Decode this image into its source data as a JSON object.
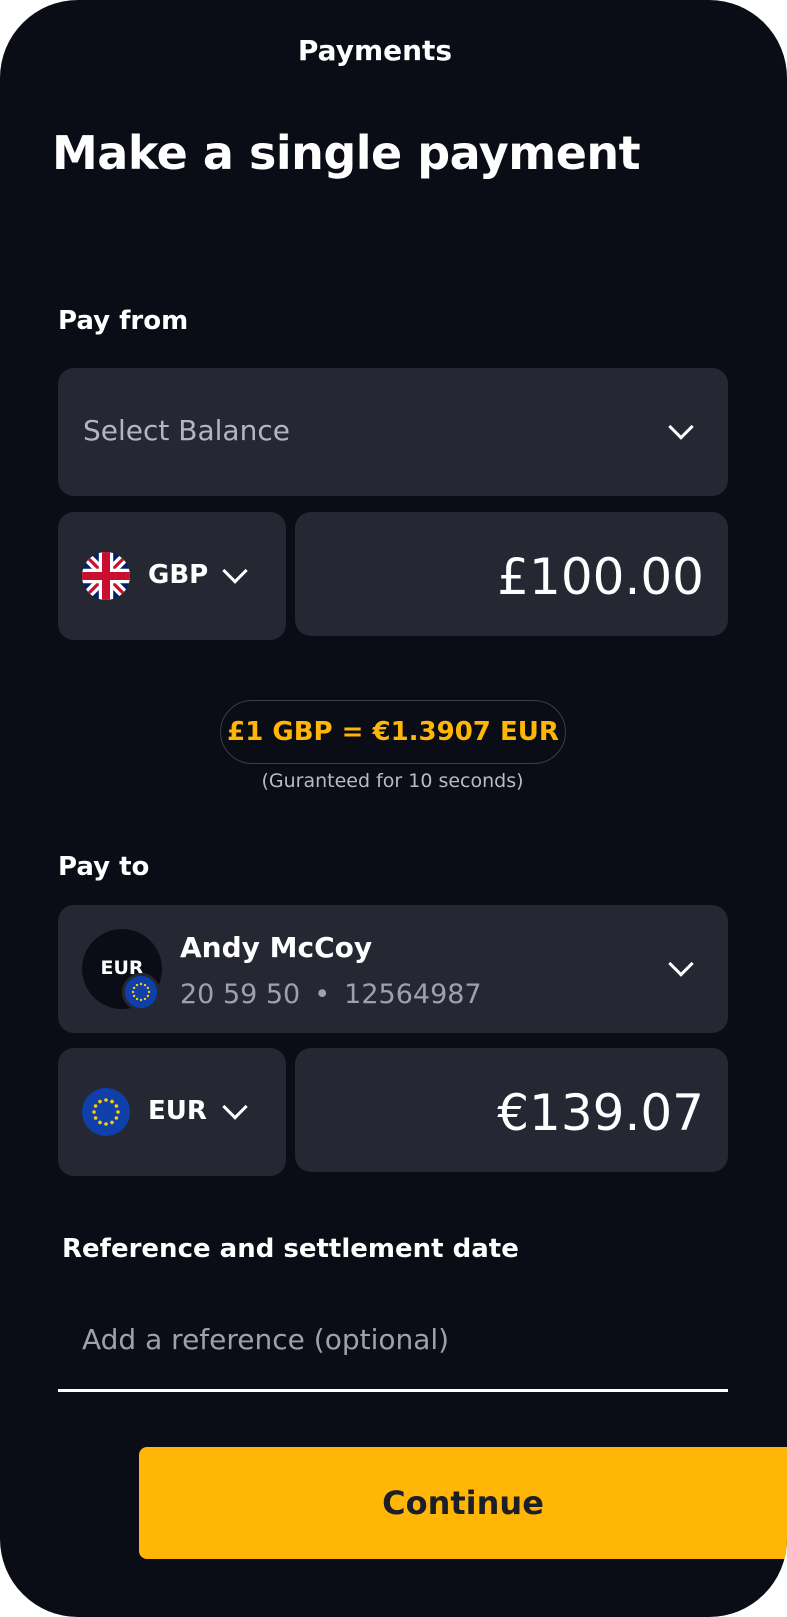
{
  "header": {
    "nav_title": "Payments",
    "page_title": "Make a single payment"
  },
  "pay_from": {
    "label": "Pay from",
    "balance_placeholder": "Select Balance",
    "currency": "GBP",
    "currency_flag_icon": "uk-flag-icon",
    "amount": "£100.00"
  },
  "exchange": {
    "rate": "£1 GBP = €1.3907 EUR",
    "note": "(Guranteed for 10 seconds)"
  },
  "pay_to": {
    "label": "Pay to",
    "payee": {
      "avatar_text": "EUR",
      "avatar_flag_icon": "eu-flag-icon",
      "name": "Andy McCoy",
      "sort_code": "20 59 50",
      "separator": "•",
      "account_number": "12564987"
    },
    "currency": "EUR",
    "currency_flag_icon": "eu-flag-icon",
    "amount": "€139.07"
  },
  "reference": {
    "label": "Reference and settlement date",
    "placeholder": "Add a reference (optional)",
    "value": ""
  },
  "actions": {
    "continue_label": "Continue"
  },
  "colors": {
    "background": "#0a0c16",
    "card": "#252733",
    "accent": "#ffb606"
  }
}
